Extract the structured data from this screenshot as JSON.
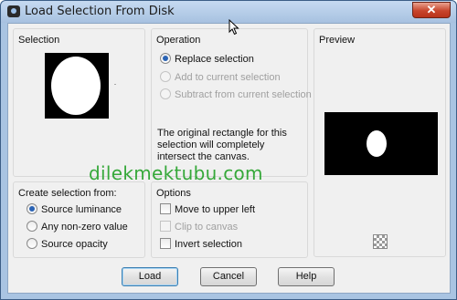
{
  "window": {
    "title": "Load Selection From Disk",
    "close_label": "✕"
  },
  "selection_panel": {
    "title": "Selection"
  },
  "operation_panel": {
    "title": "Operation",
    "options": [
      {
        "label": "Replace selection",
        "checked": true,
        "enabled": true
      },
      {
        "label": "Add to current selection",
        "checked": false,
        "enabled": false
      },
      {
        "label": "Subtract from current selection",
        "checked": false,
        "enabled": false
      }
    ],
    "description": "The original rectangle for this selection will completely intersect the canvas."
  },
  "preview_panel": {
    "title": "Preview"
  },
  "create_panel": {
    "title": "Create selection from:",
    "options": [
      {
        "label": "Source luminance",
        "checked": true
      },
      {
        "label": "Any non-zero value",
        "checked": false
      },
      {
        "label": "Source opacity",
        "checked": false
      }
    ]
  },
  "options_panel": {
    "title": "Options",
    "checks": [
      {
        "label": "Move to upper left",
        "checked": false,
        "enabled": true
      },
      {
        "label": "Clip to canvas",
        "checked": false,
        "enabled": false
      },
      {
        "label": "Invert selection",
        "checked": false,
        "enabled": true
      }
    ]
  },
  "watermark": "dilekmektubu.com",
  "buttons": {
    "load": "Load",
    "cancel": "Cancel",
    "help": "Help"
  },
  "colors": {
    "title_bar": "#a7c1e0",
    "close_button": "#c8452c",
    "watermark": "#36a83a",
    "dialog_bg": "#f0f0f0"
  },
  "icons": [
    "app-icon",
    "close-icon",
    "transparency-checker-icon",
    "mouse-cursor-icon"
  ]
}
